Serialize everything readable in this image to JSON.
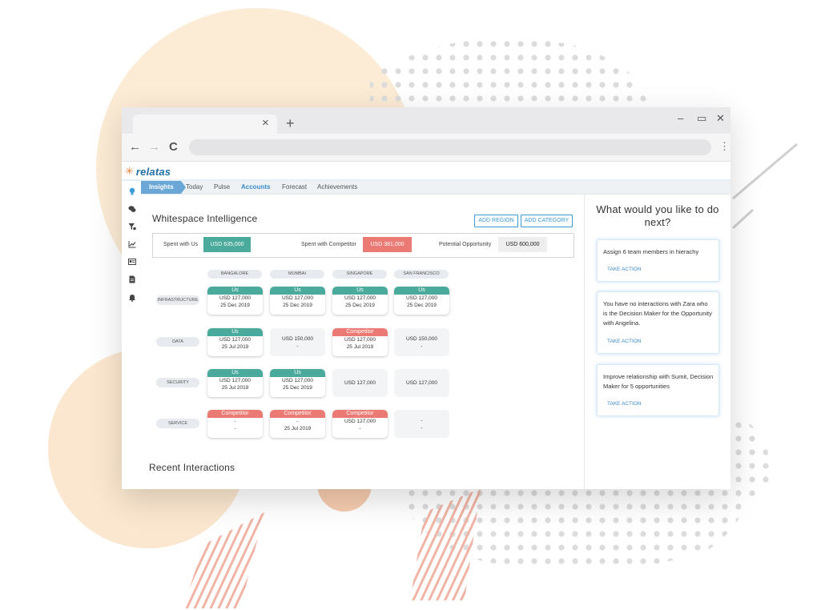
{
  "colors": {
    "accent": "#3a8bc8",
    "us": "#4aaa9c",
    "competitor": "#ec7a74",
    "logo": "#1f6fa6"
  },
  "browser": {
    "new_tab_label": "+",
    "close_tab_label": "×",
    "window_controls": {
      "minimize": "–",
      "maximize": "▭",
      "close": "✕"
    },
    "nav": {
      "back": "←",
      "forward": "→",
      "reload": "C"
    },
    "menu_icon": "⋮"
  },
  "brand": {
    "logo_text": "relatas",
    "logo_icon": "sun-asterisk-icon"
  },
  "sidebar": {
    "icons": [
      "lightbulb-icon",
      "chat-icon",
      "filter-icon",
      "line-chart-icon",
      "id-card-icon",
      "document-icon",
      "bell-icon"
    ]
  },
  "menu": {
    "items": [
      "Insights",
      "Today",
      "Pulse",
      "Accounts",
      "Forecast",
      "Achievements"
    ],
    "active": "Insights",
    "highlighted": "Accounts"
  },
  "whitespace": {
    "title": "Whitespace Intelligence",
    "add_region_label": "ADD REGION",
    "add_category_label": "ADD CATEGORY",
    "summary": {
      "spent_us_label": "Spent with Us",
      "spent_us_value": "USD 635,000",
      "spent_competitor_label": "Spent with Competitor",
      "spent_competitor_value": "USD 381,000",
      "potential_label": "Potential Opportunity",
      "potential_value": "USD 600,000"
    },
    "regions": [
      "BANGALORE",
      "MUMBAI",
      "SINGAPORE",
      "SAN FRANCISCO"
    ],
    "categories": [
      "INFRASTRUCTURE",
      "DATA",
      "SECURITY",
      "SERVICE"
    ],
    "cells": [
      [
        {
          "type": "us",
          "label": "Us",
          "amount": "USD 127,000",
          "date": "25 Dec 2019"
        },
        {
          "type": "us",
          "label": "Us",
          "amount": "USD 127,000",
          "date": "25 Dec 2019"
        },
        {
          "type": "us",
          "label": "Us",
          "amount": "USD 127,000",
          "date": "25 Dec 2019"
        },
        {
          "type": "us",
          "label": "Us",
          "amount": "USD 127,000",
          "date": "25 Dec 2019"
        }
      ],
      [
        {
          "type": "us",
          "label": "Us",
          "amount": "USD 127,000",
          "date": "25 Jul 2019"
        },
        {
          "type": "empty",
          "label": "",
          "amount": "USD 150,000",
          "date": "-"
        },
        {
          "type": "competitor",
          "label": "Competitor",
          "amount": "USD 127,000",
          "date": "25 Jul 2019"
        },
        {
          "type": "empty",
          "label": "",
          "amount": "USD 150,000",
          "date": "-"
        }
      ],
      [
        {
          "type": "us",
          "label": "Us",
          "amount": "USD 127,000",
          "date": "25 Jul 2019"
        },
        {
          "type": "us",
          "label": "Us",
          "amount": "USD 127,000",
          "date": "25 Dec 2019"
        },
        {
          "type": "empty",
          "label": "",
          "amount": "USD 127,000",
          "date": ""
        },
        {
          "type": "empty",
          "label": "",
          "amount": "USD 127,000",
          "date": ""
        }
      ],
      [
        {
          "type": "competitor",
          "label": "Competitor",
          "amount": "-",
          "date": "-"
        },
        {
          "type": "competitor",
          "label": "Competitor",
          "amount": "-",
          "date": "25 Jul 2019"
        },
        {
          "type": "competitor",
          "label": "Competitor",
          "amount": "USD 127,000",
          "date": "-"
        },
        {
          "type": "empty",
          "label": "",
          "amount": "-",
          "date": "-"
        }
      ]
    ]
  },
  "recent": {
    "title": "Recent Interactions"
  },
  "next": {
    "title": "What would you like to do next?",
    "cards": [
      {
        "text": "Assign 6 team members in hierachy",
        "action": "TAKE ACTION"
      },
      {
        "text": "You have no interactions with Zara who is the Decision Maker for the Opportunity with Angelina.",
        "action": "TAKE ACTION"
      },
      {
        "text": "Improve relationship with Sumit, Decision Maker for 5 opportunities",
        "action": "TAKE ACTION"
      }
    ]
  }
}
